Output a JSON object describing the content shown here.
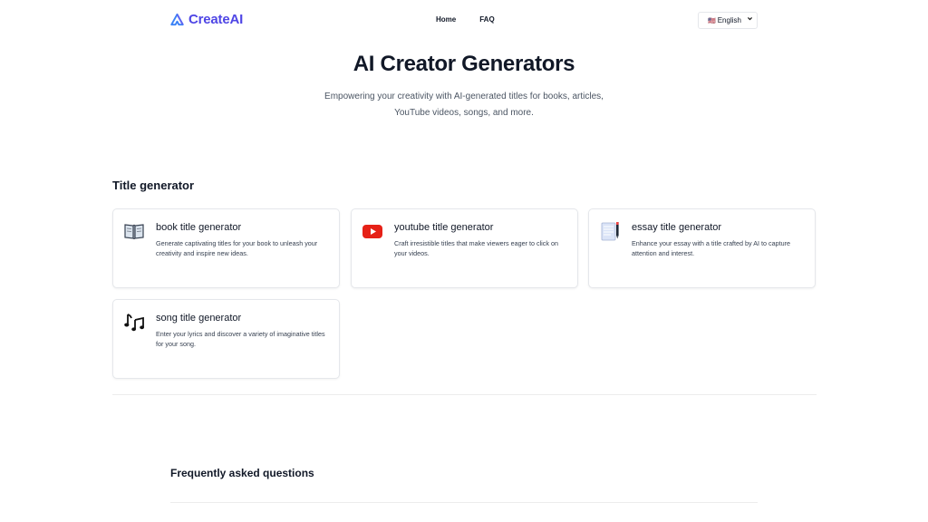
{
  "header": {
    "logo_text": "CreateAI",
    "nav": [
      {
        "label": "Home"
      },
      {
        "label": "FAQ"
      }
    ],
    "language": {
      "flag": "🇺🇸",
      "selected": "English"
    }
  },
  "hero": {
    "title": "AI Creator Generators",
    "subtitle_line1": "Empowering your creativity with AI-generated titles for books, articles,",
    "subtitle_line2": "YouTube videos, songs, and more."
  },
  "section": {
    "title": "Title generator",
    "cards": [
      {
        "title": "book title generator",
        "description": "Generate captivating titles for your book to unleash your creativity and inspire new ideas.",
        "icon": "book-icon"
      },
      {
        "title": "youtube title generator",
        "description": "Craft irresistible titles that make viewers eager to click on your videos.",
        "icon": "youtube-icon"
      },
      {
        "title": "essay title generator",
        "description": "Enhance your essay with a title crafted by AI to capture attention and interest.",
        "icon": "notebook-pen-icon"
      },
      {
        "title": "song title generator",
        "description": "Enter your lyrics and discover a variety of imaginative titles for your song.",
        "icon": "music-notes-icon"
      }
    ]
  },
  "faq": {
    "title": "Frequently asked questions"
  },
  "colors": {
    "brand": "#4f46e5",
    "youtube_red": "#e62117"
  }
}
